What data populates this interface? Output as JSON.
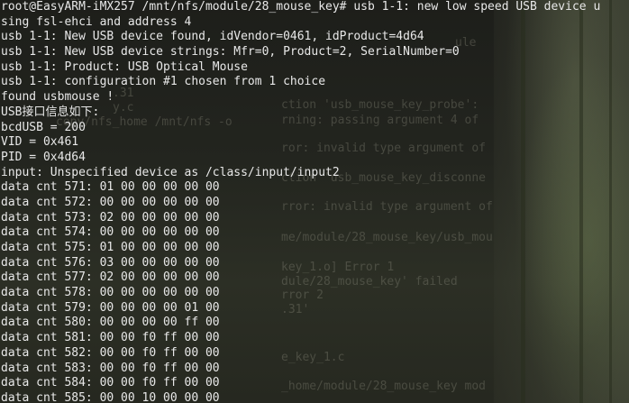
{
  "terminal": {
    "lines": [
      "root@EasyARM-iMX257 /mnt/nfs/module/28_mouse_key# usb 1-1: new low speed USB device u",
      "sing fsl-ehci and address 4",
      "usb 1-1: New USB device found, idVendor=0461, idProduct=4d64",
      "usb 1-1: New USB device strings: Mfr=0, Product=2, SerialNumber=0",
      "usb 1-1: Product: USB Optical Mouse",
      "usb 1-1: configuration #1 chosen from 1 choice",
      "found usbmouse !",
      "USB接口信息如下:",
      "bcdUSB = 200",
      "VID = 0x461",
      "PID = 0x4d64",
      "input: Unspecified device as /class/input/input2",
      "data cnt 571: 01 00 00 00 00 00",
      "data cnt 572: 00 00 00 00 00 00",
      "data cnt 573: 02 00 00 00 00 00",
      "data cnt 574: 00 00 00 00 00 00",
      "data cnt 575: 01 00 00 00 00 00",
      "data cnt 576: 03 00 00 00 00 00",
      "data cnt 577: 02 00 00 00 00 00",
      "data cnt 578: 00 00 00 00 00 00",
      "data cnt 579: 00 00 00 00 01 00",
      "data cnt 580: 00 00 00 00 ff 00",
      "data cnt 581: 00 00 f0 ff 00 00",
      "data cnt 582: 00 00 f0 ff 00 00",
      "data cnt 583: 00 00 f0 ff 00 00",
      "data cnt 584: 00 00 f0 ff 00 00",
      "data cnt 585: 00 00 10 00 00 00"
    ],
    "background_text": [
      "ule",
      ".31",
      "y.c",
      "copy/nfs_home /mnt/nfs -o",
      "ction 'usb_mouse_key_probe':",
      "rning: passing argument 4 of",
      "ror: invalid type argument of",
      "ction 'usb_mouse_key_disconne",
      "rror: invalid type argument of",
      "me/module/28_mouse_key/usb_mou",
      "key_1.o] Error 1",
      "dule/28_mouse_key' failed",
      "rror 2",
      ".31'",
      "e_key_1.c",
      "_home/module/28_mouse_key mod"
    ],
    "colors": {
      "foreground": "#e8e8e8",
      "background": "#23251f"
    }
  }
}
